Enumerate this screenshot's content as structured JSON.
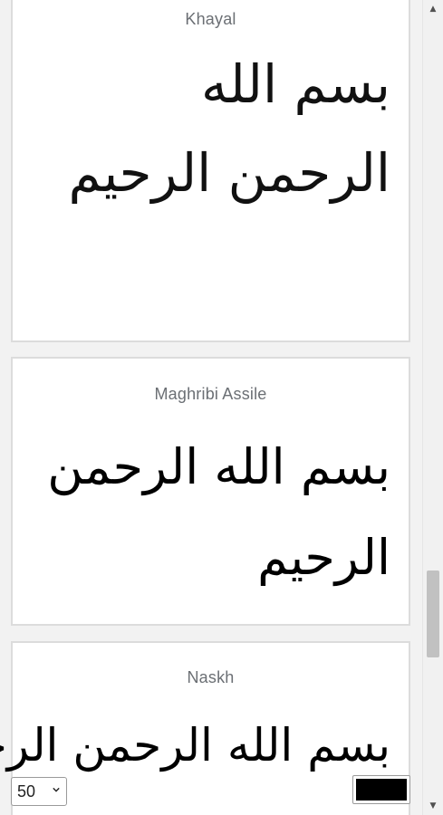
{
  "cards": [
    {
      "font_name": "Khayal",
      "sample_text": "بسم الله الرحمن الرحيم"
    },
    {
      "font_name": "Maghribi Assile",
      "sample_text": "بسم الله الرحمن الرحيم"
    },
    {
      "font_name": "Naskh",
      "sample_text": "بسم الله الرحمن الرحيم"
    }
  ],
  "controls": {
    "font_size_value": "50",
    "text_color": "#000000"
  },
  "icons": {
    "select_chevron": "chevron-down-icon",
    "scroll_up": "triangle-up-icon",
    "scroll_down": "triangle-down-icon"
  }
}
